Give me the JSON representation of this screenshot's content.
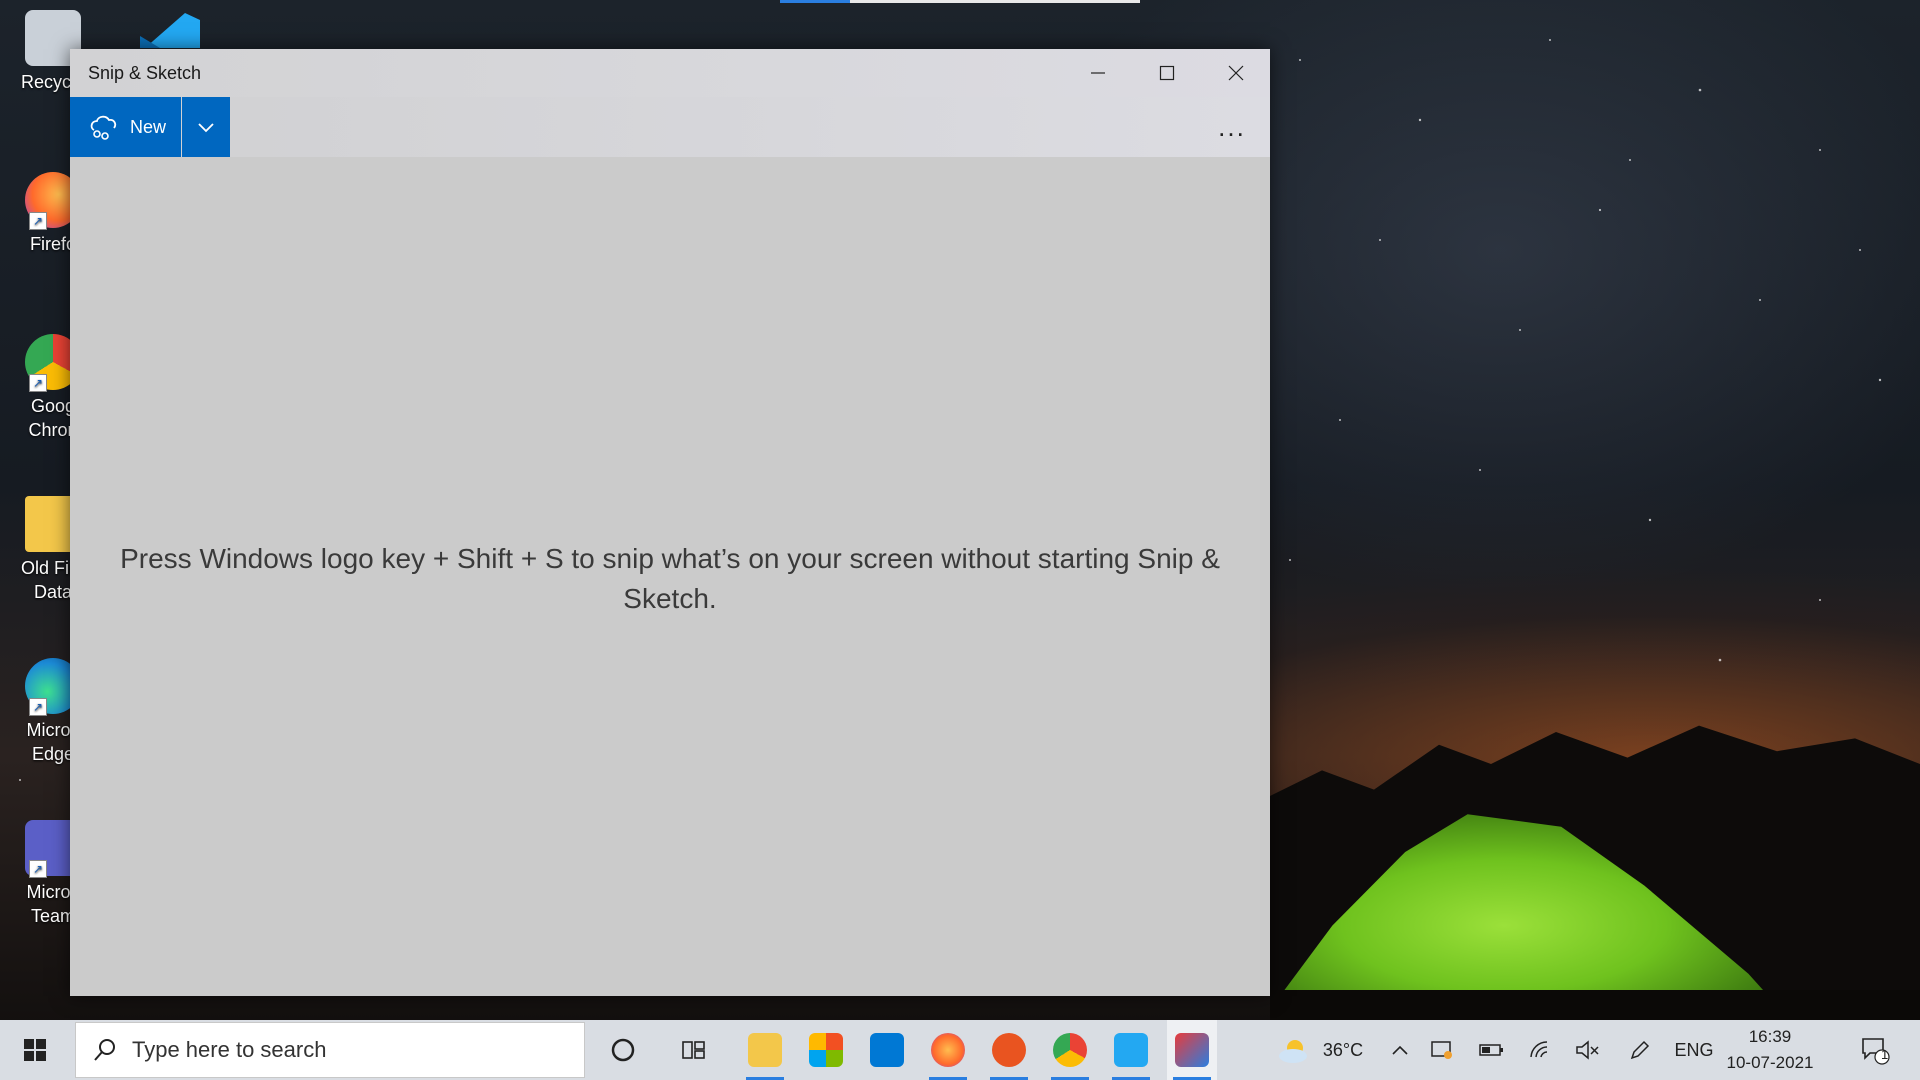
{
  "desktop": {
    "icons": [
      {
        "label": "Recycle",
        "name": "recycle-bin-icon",
        "color": "#bfc7d0"
      },
      {
        "label": "Firefo",
        "name": "firefox-icon",
        "color": "#ff7139"
      },
      {
        "label": "Goog\nChron",
        "name": "chrome-icon",
        "color": "#34a853"
      },
      {
        "label": "Old Fire\nData",
        "name": "folder-icon",
        "color": "#f3c74a"
      },
      {
        "label": "Micros\nEdge",
        "name": "edge-icon",
        "color": "#1c8bd6"
      },
      {
        "label": "Micros\nTeam",
        "name": "teams-icon",
        "color": "#5b5fc7"
      }
    ]
  },
  "window": {
    "title": "Snip & Sketch",
    "new_label": "New",
    "more_label": "...",
    "hint": "Press Windows logo key + Shift + S to snip what’s on your screen without starting Snip & Sketch."
  },
  "taskbar": {
    "search_placeholder": "Type here to search",
    "weather": "36°C",
    "language": "ENG",
    "time": "16:39",
    "date": "10-07-2021",
    "notification_count": "1"
  },
  "colors": {
    "accent": "#0067c0",
    "window_bg": "#cbcbcb",
    "taskbar_bg": "#d9dde3"
  }
}
